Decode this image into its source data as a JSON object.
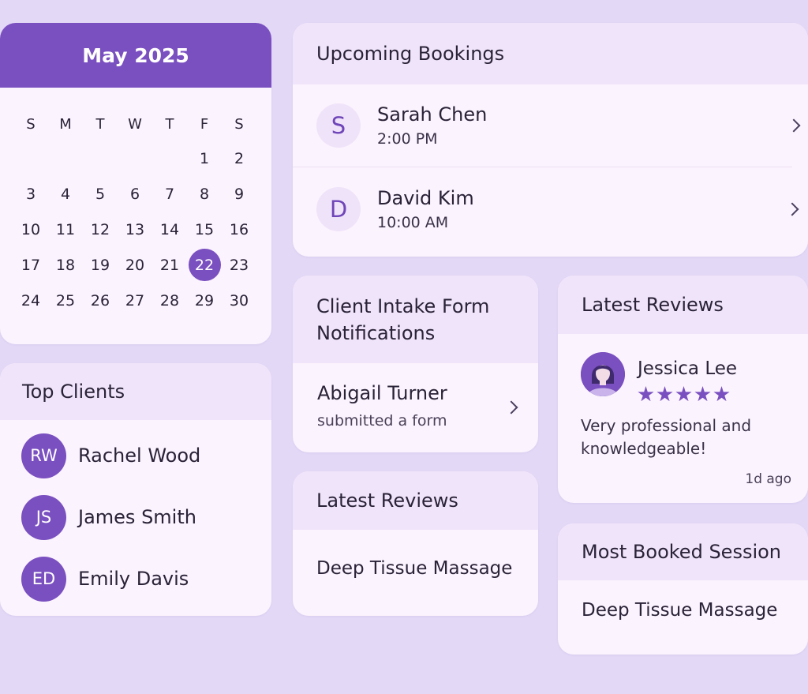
{
  "calendar": {
    "month_title": "May 2025",
    "weekdays": [
      "S",
      "M",
      "T",
      "W",
      "T",
      "F",
      "S"
    ],
    "leading_blanks": 5,
    "days": [
      1,
      2,
      3,
      4,
      5,
      6,
      7,
      8,
      9,
      10,
      11,
      12,
      13,
      14,
      15,
      16,
      17,
      18,
      19,
      20,
      21,
      22,
      23,
      24,
      25,
      26,
      27,
      28,
      29,
      30
    ],
    "selected_day": 22
  },
  "top_clients": {
    "title": "Top Clients",
    "clients": [
      {
        "initials": "RW",
        "name": "Rachel Wood"
      },
      {
        "initials": "JS",
        "name": "James Smith"
      },
      {
        "initials": "ED",
        "name": "Emily Davis"
      }
    ]
  },
  "bookings": {
    "title": "Upcoming Bookings",
    "items": [
      {
        "letter": "S",
        "name": "Sarah Chen",
        "time": "2:00 PM"
      },
      {
        "letter": "D",
        "name": "David Kim",
        "time": "10:00 AM"
      }
    ]
  },
  "intake": {
    "title_line1": "Client Intake Form",
    "title_line2": "Notifications",
    "name": "Abigail Turner",
    "subtitle": "submitted a form"
  },
  "reviews_small": {
    "title": "Latest Reviews",
    "session": "Deep Tissue Massage"
  },
  "reviews": {
    "title": "Latest Reviews",
    "reviewer": "Jessica Lee",
    "rating": 5,
    "text": "Very professional and knowledgeable!",
    "time": "1d ago"
  },
  "most_booked": {
    "title": "Most Booked Session",
    "session": "Deep Tissue Massage"
  },
  "colors": {
    "accent": "#7a4fc0",
    "background": "#e3d8f6",
    "card": "#fbf3fd",
    "card_header": "#f0e4fa"
  }
}
